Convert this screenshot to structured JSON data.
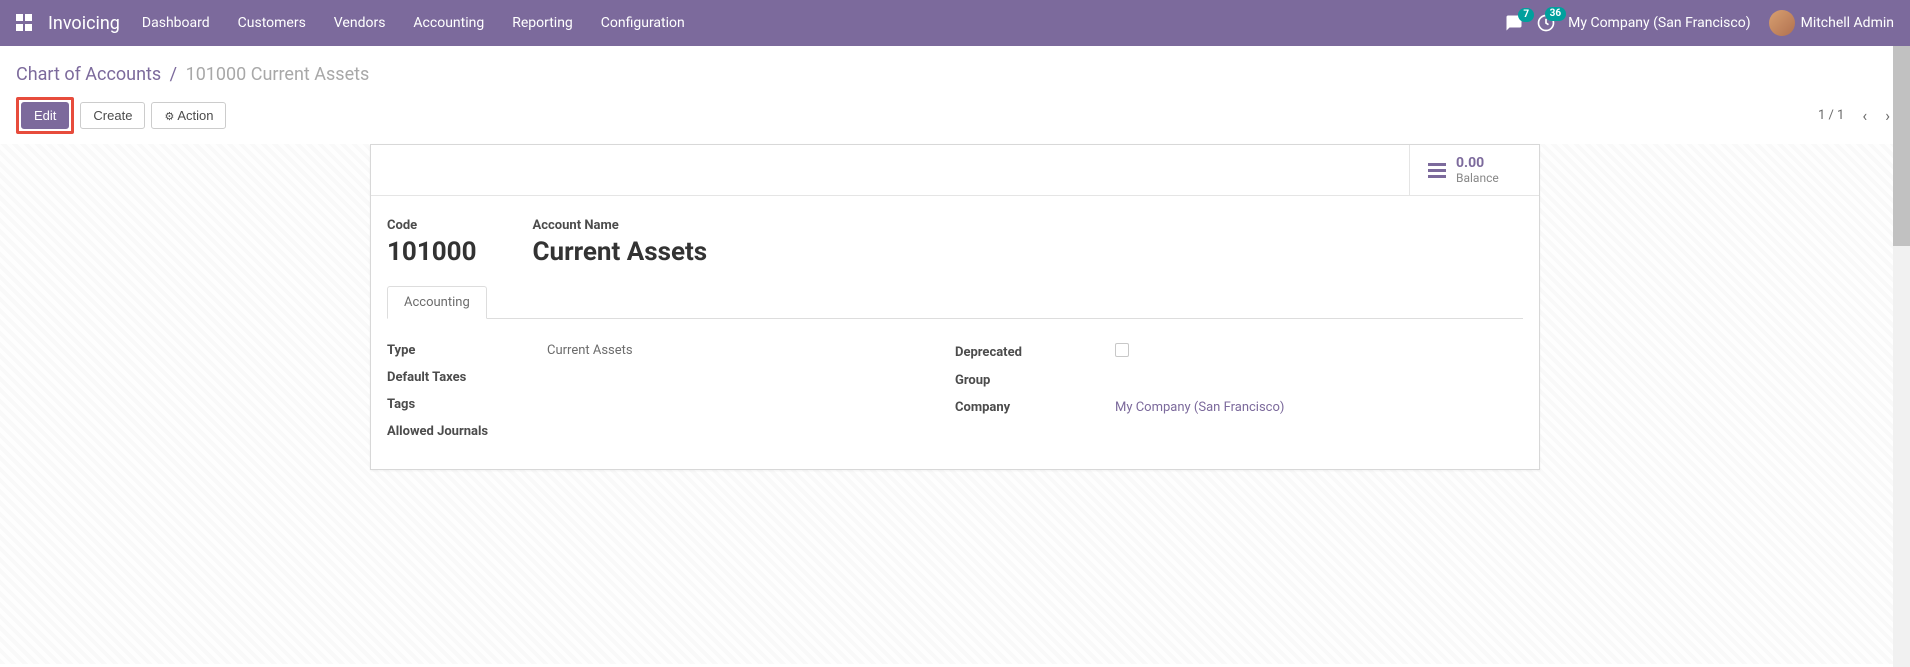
{
  "navbar": {
    "brand": "Invoicing",
    "menu": [
      "Dashboard",
      "Customers",
      "Vendors",
      "Accounting",
      "Reporting",
      "Configuration"
    ],
    "messages_badge": "7",
    "activity_badge": "36",
    "company": "My Company (San Francisco)",
    "user": "Mitchell Admin"
  },
  "breadcrumb": {
    "parent": "Chart of Accounts",
    "current": "101000 Current Assets"
  },
  "buttons": {
    "edit": "Edit",
    "create": "Create",
    "action": "Action"
  },
  "pager": {
    "counter": "1 / 1"
  },
  "stat": {
    "balance_value": "0.00",
    "balance_label": "Balance"
  },
  "titles": {
    "code_label": "Code",
    "code_value": "101000",
    "name_label": "Account Name",
    "name_value": "Current Assets"
  },
  "tab": {
    "accounting": "Accounting"
  },
  "fields": {
    "type_label": "Type",
    "type_value": "Current Assets",
    "default_taxes_label": "Default Taxes",
    "tags_label": "Tags",
    "allowed_journals_label": "Allowed Journals",
    "deprecated_label": "Deprecated",
    "group_label": "Group",
    "company_label": "Company",
    "company_value": "My Company (San Francisco)"
  }
}
